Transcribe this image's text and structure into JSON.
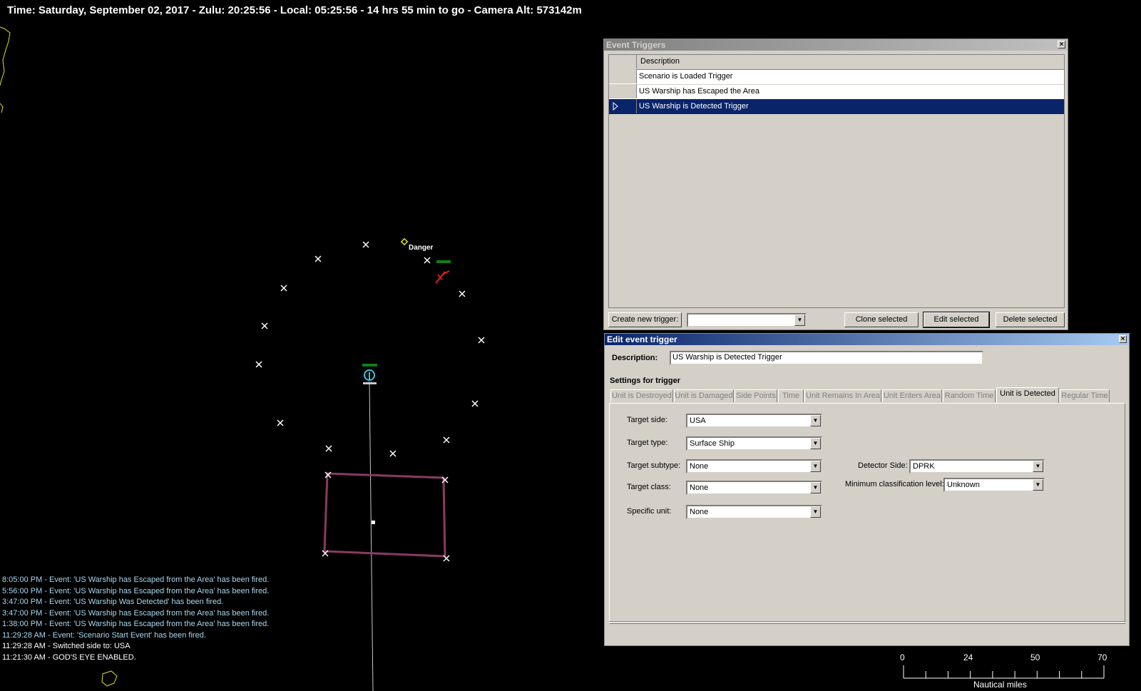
{
  "status_bar": {
    "text": "Time: Saturday, September 02, 2017 - Zulu: 20:25:56 - Local: 05:25:56 - 14 hrs 55 min to go -  Camera Alt: 573142m"
  },
  "map": {
    "danger_label": "Danger",
    "scale": {
      "ticks": [
        "0",
        "24",
        "50",
        "70"
      ],
      "unit": "Nautical miles"
    },
    "colors": {
      "area": "#8a3a64",
      "coast": "#e0e020",
      "marker": "#ffffff",
      "unit_friendly": "#40c0e0",
      "unit_hostile": "#e02020"
    }
  },
  "message_log": [
    {
      "text": "8:05:00 PM - Event: 'US Warship has Escaped from the Area' has been fired.",
      "color": "#a8d8f0"
    },
    {
      "text": "5:56:00 PM - Event: 'US Warship has Escaped from the Area' has been fired.",
      "color": "#a8d8f0"
    },
    {
      "text": "3:47:00 PM - Event: 'US Warship Was Detected' has been fired.",
      "color": "#a8d8f0"
    },
    {
      "text": "3:47:00 PM - Event: 'US Warship has Escaped from the Area' has been fired.",
      "color": "#a8d8f0"
    },
    {
      "text": "1:38:00 PM - Event: 'US Warship has Escaped from the Area' has been fired.",
      "color": "#a8d8f0"
    },
    {
      "text": "11:29:28 AM - Event: 'Scenario Start Event' has been fired.",
      "color": "#a8d8f0"
    },
    {
      "text": "11:29:28 AM - Switched side to: USA",
      "color": "#ffffff"
    },
    {
      "text": "11:21:30 AM - GOD'S EYE ENABLED.",
      "color": "#ffffff"
    }
  ],
  "event_triggers": {
    "title": "Event Triggers",
    "column_header": "Description",
    "rows": [
      {
        "description": "Scenario is Loaded Trigger",
        "selected": false
      },
      {
        "description": "US Warship has Escaped the Area",
        "selected": false
      },
      {
        "description": "US Warship is Detected Trigger",
        "selected": true
      }
    ],
    "create_label": "Create new trigger:",
    "create_value": "",
    "clone_label": "Clone selected",
    "edit_label": "Edit selected",
    "delete_label": "Delete selected"
  },
  "edit_trigger": {
    "title": "Edit event trigger",
    "description_label": "Description:",
    "description_value": "US Warship is Detected Trigger",
    "settings_label": "Settings for trigger",
    "tabs": [
      {
        "label": "Unit is Destroyed",
        "active": false
      },
      {
        "label": "Unit is Damaged",
        "active": false
      },
      {
        "label": "Side Points",
        "active": false
      },
      {
        "label": "Time",
        "active": false
      },
      {
        "label": "Unit Remains In Area",
        "active": false
      },
      {
        "label": "Unit Enters Area",
        "active": false
      },
      {
        "label": "Random Time",
        "active": false
      },
      {
        "label": "Unit is Detected",
        "active": true
      },
      {
        "label": "Regular Time",
        "active": false
      }
    ],
    "fields": {
      "target_side": {
        "label": "Target side:",
        "value": "USA"
      },
      "target_type": {
        "label": "Target type:",
        "value": "Surface Ship"
      },
      "target_subtype": {
        "label": "Target subtype:",
        "value": "None"
      },
      "target_class": {
        "label": "Target class:",
        "value": "None"
      },
      "specific_unit": {
        "label": "Specific unit:",
        "value": "None"
      },
      "detector_side": {
        "label": "Detector Side:",
        "value": "DPRK"
      },
      "min_classification": {
        "label": "Minimum classification level:",
        "value": "Unknown"
      }
    }
  }
}
